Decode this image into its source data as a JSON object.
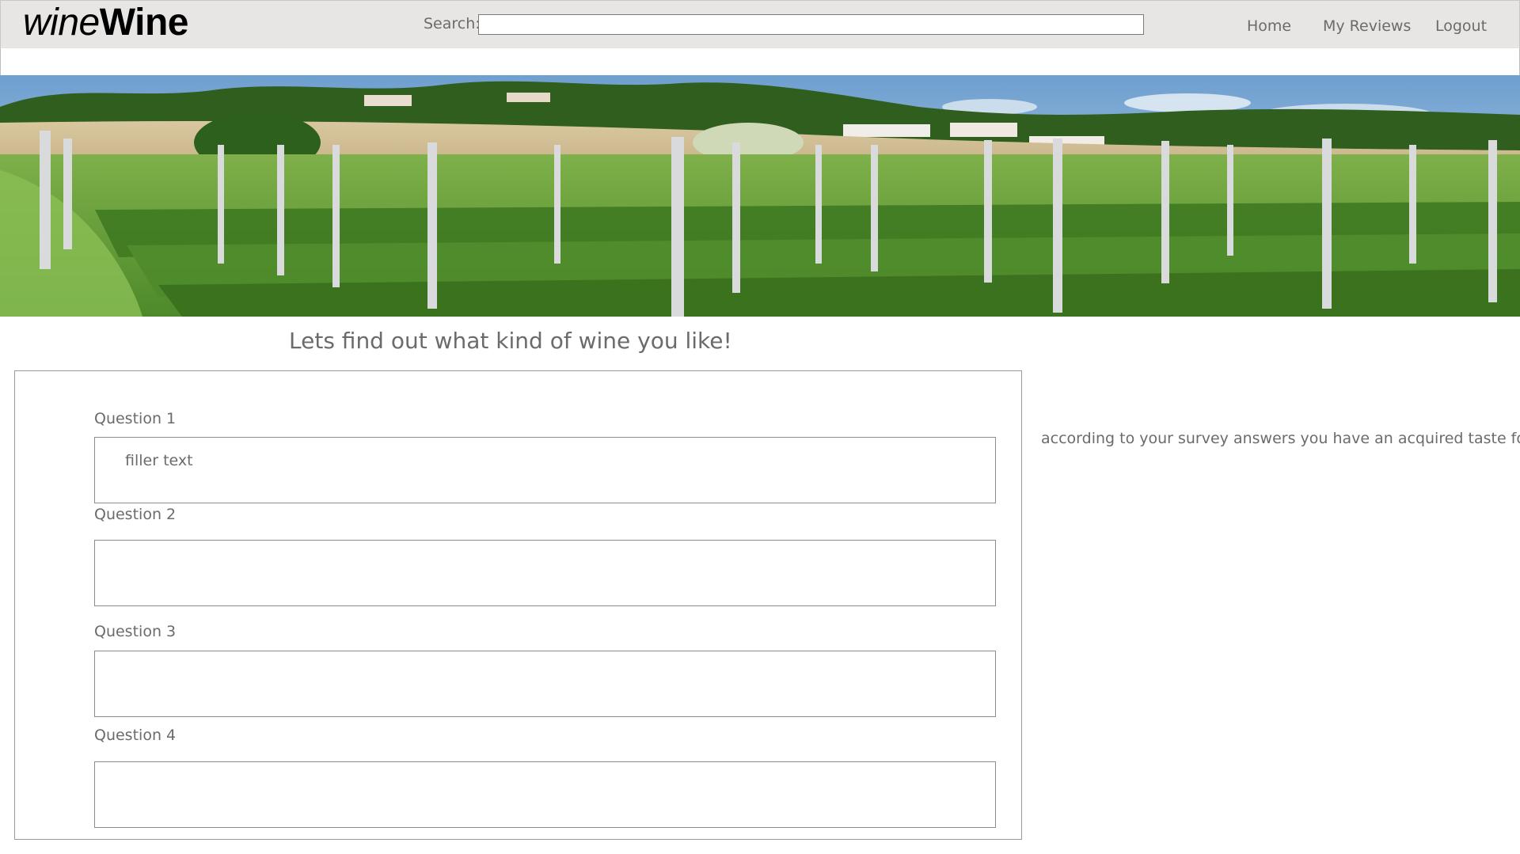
{
  "header": {
    "logo_light": "wine",
    "logo_bold": "Wine",
    "search_label": "Search:",
    "search_value": "",
    "nav": [
      "Home",
      "My Reviews",
      "Logout"
    ]
  },
  "banner": {
    "alt": "vineyard-banner"
  },
  "main": {
    "headline": "Lets find out what kind of wine you like!",
    "questions": [
      {
        "label": "Question 1",
        "value": "filler text"
      },
      {
        "label": "Question 2",
        "value": ""
      },
      {
        "label": "Question 3",
        "value": ""
      },
      {
        "label": "Question 4",
        "value": ""
      }
    ],
    "result_text": "according to your survey answers you have an acquired taste for......"
  },
  "colors": {
    "header_bg": "#e8e6e5",
    "text": "#6b6b6b",
    "logo": "#000000"
  }
}
